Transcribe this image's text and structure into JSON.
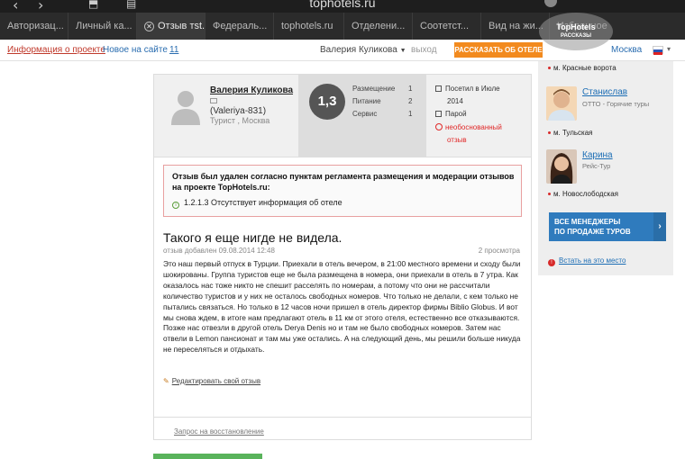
{
  "browser": {
    "url": "tophotels.ru"
  },
  "tabs": [
    {
      "label": "Авторизац..."
    },
    {
      "label": "Личный ка..."
    },
    {
      "label": "Отзыв тst...",
      "active": true
    },
    {
      "label": "Федераль..."
    },
    {
      "label": "tophotels.ru"
    },
    {
      "label": "Отделени..."
    },
    {
      "label": "Соотетст..."
    },
    {
      "label": "Вид на жи..."
    },
    {
      "label": "Избранное"
    }
  ],
  "topnav": {
    "about": "Информация о проекте",
    "new": "Новое на сайте",
    "new_count": "11",
    "user": "Валерия Куликова",
    "logout": "выход",
    "tell_button": "РАССКАЗАТЬ ОБ ОТЕЛЕ",
    "city": "Москва"
  },
  "logo": {
    "line1": "TopHotels",
    "line2": "РАССКАЗЫ"
  },
  "review": {
    "author_name": "Валерия Куликова",
    "author_login": "(Valeriya-831)",
    "author_info": "Турист , Москва",
    "score": "1,3",
    "ratings": [
      {
        "label": "Размещение",
        "value": "1"
      },
      {
        "label": "Питание",
        "value": "2"
      },
      {
        "label": "Сервис",
        "value": "1"
      }
    ],
    "visit_date_line1": "Посетил в Июле",
    "visit_date_line2": "2014",
    "companions": "Парой",
    "status_line1": "необоснованный",
    "status_line2": "отзыв",
    "notice_title": "Отзыв был удален согласно пунктам регламента размещения и модерации отзывов на проекте TopHotels.ru:",
    "notice_item": "1.2.1.3 Отсутствует информация об отеле",
    "title": "Такого я еще нигде не видела.",
    "added": "отзыв добавлен 09.08.2014 12:48",
    "views": "2 просмотра",
    "text": "Это наш первый отпуск в Турции. Приехали в отель вечером, в 21:00 местного времени и сходу были шокированы. Группа туристов еще не была размещена в номера, они приехали в отель в 7 утра. Как оказалось нас тоже никто не спешит расселять по номерам, а потому что они не рассчитали количество туристов и у них не осталось свободных номеров. Что только не делали, с кем только не пытались связаться. Но только в 12 часов ночи пришел в отель директор фирмы Biblio Globus. И вот мы снова ждем, в итоге нам предлагают отель в 11 км от этого отеля, естественно все отказываются. Позже нас отвезли в другой отель Derya Denis но и там не было свободных номеров. Затем нас отвели в Lemon пансионат и там мы уже остались. А на следующий день, мы решили больше никуда не переселяться и отдыхать.",
    "edit": "Редактировать свой отзыв",
    "restore": "Запрос на восстановление"
  },
  "sidebar": {
    "metro_top": "м. Красные ворота",
    "managers": [
      {
        "name": "Станислав",
        "company": "ОТТО - Горячие туры",
        "metro": "м. Тульская"
      },
      {
        "name": "Карина",
        "company": "Рейс-Тур",
        "metro": "м. Новослободская"
      }
    ],
    "all_managers_line1": "ВСЕ МЕНЕДЖЕРЫ",
    "all_managers_line2": "ПО ПРОДАЖЕ ТУРОВ",
    "report": "Встать на это место"
  }
}
